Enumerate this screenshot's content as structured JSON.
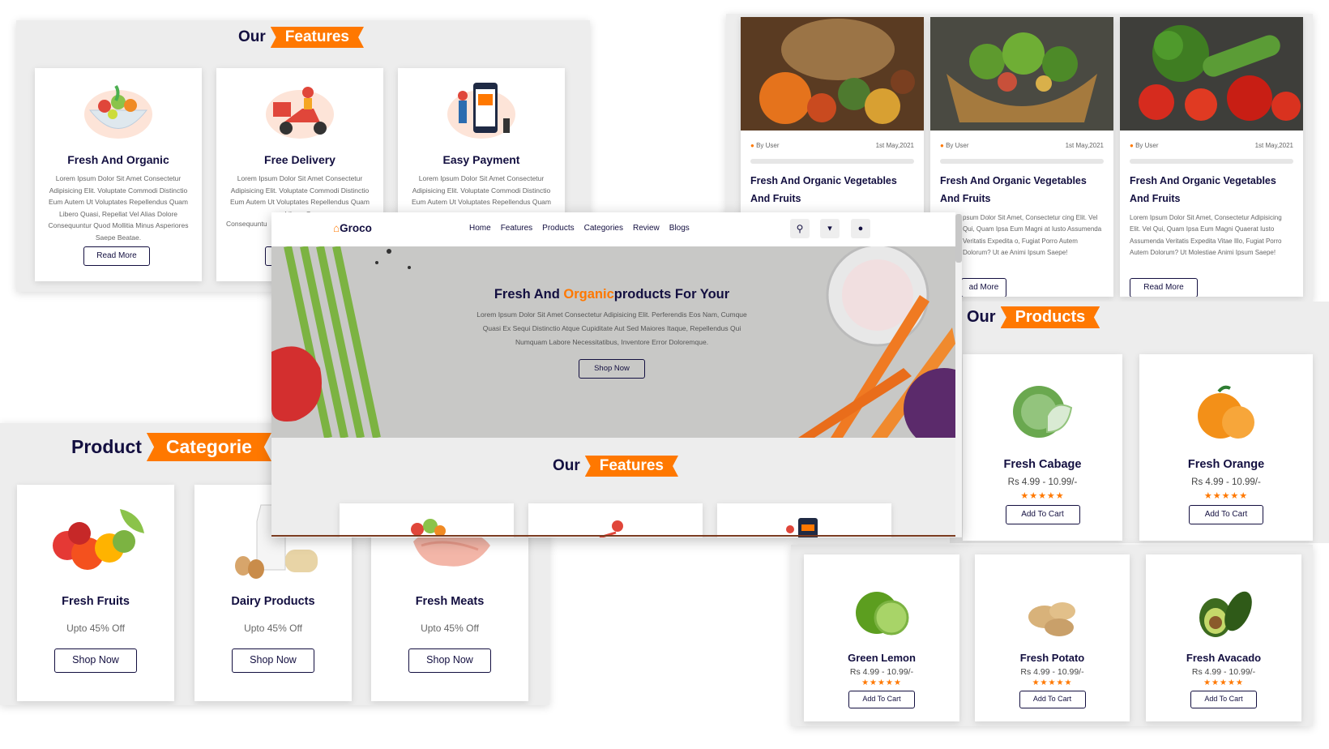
{
  "features_panel": {
    "heading_plain": "Our",
    "heading_tag": "Features",
    "cards": [
      {
        "title": "Fresh And Organic",
        "icon": "salad-bowl-icon",
        "text": "Lorem Ipsum Dolor Sit Amet Consectetur Adipisicing Elit. Voluptate Commodi Distinctio Eum Autem Ut Voluptates Repellendus Quam Libero Quasi, Repellat Vel Alias Dolore Consequuntur Quod Mollitia Minus Asperiores Saepe Beatae.",
        "button": "Read More"
      },
      {
        "title": "Free Delivery",
        "icon": "delivery-scooter-icon",
        "text": "Lorem Ipsum Dolor Sit Amet Consectetur Adipisicing Elit. Voluptate Commodi Distinctio Eum Autem Ut Voluptates Repellendus Quam Libero Qu",
        "text_tail": "Consequuntu",
        "button": "Read More"
      },
      {
        "title": "Easy Payment",
        "icon": "mobile-payment-icon",
        "text": "Lorem Ipsum Dolor Sit Amet Consectetur Adipisicing Elit. Voluptate Commodi Distinctio Eum Autem Ut Voluptates Repellendus Quam"
      }
    ]
  },
  "blogs_panel": {
    "cards": [
      {
        "image": "pumpkin-basket-image",
        "author": "By User",
        "date": "1st May,2021",
        "title": "Fresh And Organic Vegetables And Fruits"
      },
      {
        "image": "vegetable-basket-image",
        "author": "By User",
        "date": "1st May,2021",
        "title": "Fresh And Organic Vegetables And Fruits",
        "text": "psum Dolor Sit Amet, Consectetur cing Elit. Vel Qui, Quam Ipsa Eum Magni at Iusto Assumenda Veritatis Expedita o, Fugiat Porro Autem Dolorum? Ut ae Animi Ipsum Saepe!",
        "button": "ad More"
      },
      {
        "image": "broccoli-tomato-image",
        "author": "By User",
        "date": "1st May,2021",
        "title": "Fresh And Organic Vegetables And Fruits",
        "text": "Lorem Ipsum Dolor Sit Amet, Consectetur Adipisicing Elit. Vel Qui, Quam Ipsa Eum Magni Quaerat Iusto Assumenda Veritatis Expedita Vitae Illo, Fugiat Porro Autem Dolorum? Ut Molestiae Animi Ipsum Saepe!",
        "button": "Read More"
      }
    ]
  },
  "products_panel": {
    "heading_plain": "Our",
    "heading_tag": "Products",
    "price": "Rs 4.99 - 10.99/-",
    "stars": "★★★★★",
    "button": "Add To Cart",
    "items": [
      {
        "name": "Fresh Cabage",
        "image": "cabbage-image"
      },
      {
        "name": "Fresh Orange",
        "image": "orange-image"
      },
      {
        "name": "Green Lemon",
        "image": "lemon-image"
      },
      {
        "name": "Fresh Potato",
        "image": "potato-image"
      },
      {
        "name": "Fresh Avacado",
        "image": "avocado-image"
      }
    ]
  },
  "categories_panel": {
    "heading_plain": "Product",
    "heading_tag": "Categorie",
    "button": "Shop Now",
    "items": [
      {
        "name": "Fresh Fruits",
        "discount": "Upto 45% Off",
        "image": "fruits-image"
      },
      {
        "name": "Dairy Products",
        "discount": "Upto 45% Off",
        "image": "dairy-image"
      },
      {
        "name": "Fresh Meats",
        "discount": "Upto 45% Off",
        "image": "meat-image"
      }
    ]
  },
  "main_window": {
    "logo": "Groco",
    "nav": [
      "Home",
      "Features",
      "Products",
      "Categories",
      "Review",
      "Blogs"
    ],
    "hero": {
      "title_a": "Fresh And ",
      "title_highlight": "Organic",
      "title_b": "products For Your",
      "text": "Lorem Ipsum Dolor Sit Amet Consectetur Adipisicing Elit. Perferendis Eos Nam, Cumque Quasi Ex Sequi Distinctio Atque Cupiditate Aut Sed Maiores Itaque, Repellendus Qui Numquam Labore Necessitatibus, Inventore Error Doloremque.",
      "button": "Shop Now"
    },
    "features_heading_plain": "Our",
    "features_heading_tag": "Features"
  },
  "colors": {
    "accent": "#ff7800",
    "dark": "#130f40",
    "panel": "#ededed"
  }
}
